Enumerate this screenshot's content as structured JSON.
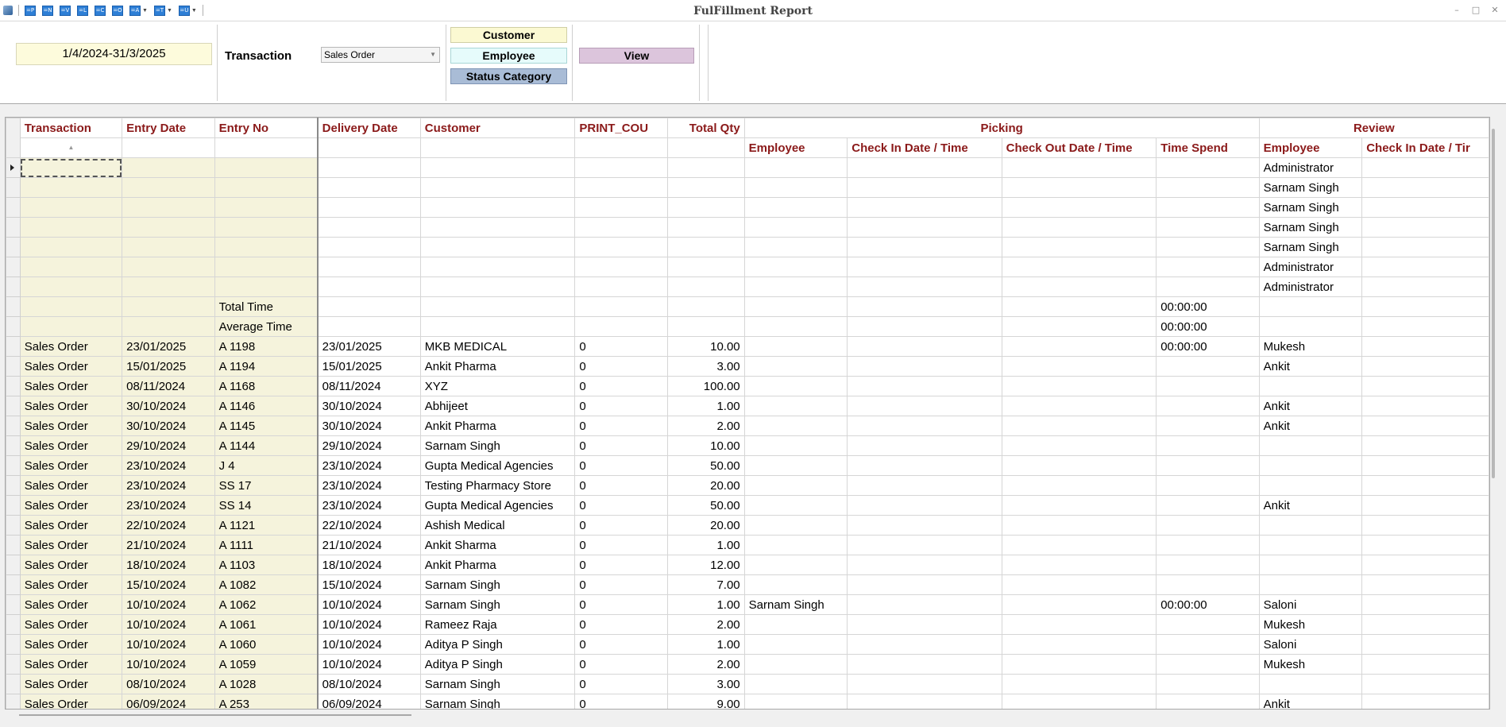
{
  "window": {
    "title": "FulFillment Report",
    "toolbar_buttons": [
      "=P",
      "=N",
      "=V",
      "=L",
      "=C",
      "=O",
      "=A",
      "=T",
      "=U"
    ]
  },
  "filter": {
    "date_range": "1/4/2024-31/3/2025",
    "transaction_label": "Transaction",
    "transaction_value": "Sales Order",
    "customer_button": "Customer",
    "employee_button": "Employee",
    "status_button": "Status Category",
    "view_button": "View",
    "colors": {
      "customer_bg": "#fbf9d2",
      "employee_bg": "#e6fbfb",
      "status_bg": "#a9bcd6",
      "view_bg": "#dcc5dc"
    }
  },
  "grid": {
    "header_color": "#8b1a1a",
    "columns": [
      "Transaction",
      "Entry Date",
      "Entry No",
      "Delivery Date",
      "Customer",
      "PRINT_COU",
      "Total Qty"
    ],
    "group_picking": "Picking",
    "group_review": "Review",
    "sub_columns": [
      "Employee",
      "Check In Date / Time",
      "Check Out Date / Time",
      "Time Spend",
      "Employee",
      "Check In Date / Tir"
    ],
    "rows": [
      [
        "",
        "",
        "",
        "",
        "",
        "",
        "",
        "",
        "",
        "",
        "",
        "Administrator",
        ""
      ],
      [
        "",
        "",
        "",
        "",
        "",
        "",
        "",
        "",
        "",
        "",
        "",
        "Sarnam Singh",
        ""
      ],
      [
        "",
        "",
        "",
        "",
        "",
        "",
        "",
        "",
        "",
        "",
        "",
        "Sarnam Singh",
        ""
      ],
      [
        "",
        "",
        "",
        "",
        "",
        "",
        "",
        "",
        "",
        "",
        "",
        "Sarnam Singh",
        ""
      ],
      [
        "",
        "",
        "",
        "",
        "",
        "",
        "",
        "",
        "",
        "",
        "",
        "Sarnam Singh",
        ""
      ],
      [
        "",
        "",
        "",
        "",
        "",
        "",
        "",
        "",
        "",
        "",
        "",
        "Administrator",
        ""
      ],
      [
        "",
        "",
        "",
        "",
        "",
        "",
        "",
        "",
        "",
        "",
        "",
        "Administrator",
        ""
      ],
      [
        "",
        "",
        "Total Time",
        "",
        "",
        "",
        "",
        "",
        "",
        "",
        "00:00:00",
        "",
        ""
      ],
      [
        "",
        "",
        "Average Time",
        "",
        "",
        "",
        "",
        "",
        "",
        "",
        "00:00:00",
        "",
        ""
      ],
      [
        "Sales Order",
        "23/01/2025",
        "A 1198",
        "23/01/2025",
        "MKB MEDICAL",
        "0",
        "10.00",
        "",
        "",
        "",
        "00:00:00",
        "Mukesh",
        ""
      ],
      [
        "Sales Order",
        "15/01/2025",
        "A 1194",
        "15/01/2025",
        "Ankit Pharma",
        "0",
        "3.00",
        "",
        "",
        "",
        "",
        "Ankit",
        ""
      ],
      [
        "Sales Order",
        "08/11/2024",
        "A 1168",
        "08/11/2024",
        "XYZ",
        "0",
        "100.00",
        "",
        "",
        "",
        "",
        "",
        ""
      ],
      [
        "Sales Order",
        "30/10/2024",
        "A 1146",
        "30/10/2024",
        "Abhijeet",
        "0",
        "1.00",
        "",
        "",
        "",
        "",
        "Ankit",
        ""
      ],
      [
        "Sales Order",
        "30/10/2024",
        "A 1145",
        "30/10/2024",
        "Ankit Pharma",
        "0",
        "2.00",
        "",
        "",
        "",
        "",
        "Ankit",
        ""
      ],
      [
        "Sales Order",
        "29/10/2024",
        "A 1144",
        "29/10/2024",
        "Sarnam Singh",
        "0",
        "10.00",
        "",
        "",
        "",
        "",
        "",
        ""
      ],
      [
        "Sales Order",
        "23/10/2024",
        "J 4",
        "23/10/2024",
        "Gupta Medical Agencies",
        "0",
        "50.00",
        "",
        "",
        "",
        "",
        "",
        ""
      ],
      [
        "Sales Order",
        "23/10/2024",
        "SS 17",
        "23/10/2024",
        "Testing Pharmacy Store",
        "0",
        "20.00",
        "",
        "",
        "",
        "",
        "",
        ""
      ],
      [
        "Sales Order",
        "23/10/2024",
        "SS 14",
        "23/10/2024",
        "Gupta Medical Agencies",
        "0",
        "50.00",
        "",
        "",
        "",
        "",
        "Ankit",
        ""
      ],
      [
        "Sales Order",
        "22/10/2024",
        "A 1121",
        "22/10/2024",
        "Ashish Medical",
        "0",
        "20.00",
        "",
        "",
        "",
        "",
        "",
        ""
      ],
      [
        "Sales Order",
        "21/10/2024",
        "A 1111",
        "21/10/2024",
        "Ankit Sharma",
        "0",
        "1.00",
        "",
        "",
        "",
        "",
        "",
        ""
      ],
      [
        "Sales Order",
        "18/10/2024",
        "A 1103",
        "18/10/2024",
        "Ankit Pharma",
        "0",
        "12.00",
        "",
        "",
        "",
        "",
        "",
        ""
      ],
      [
        "Sales Order",
        "15/10/2024",
        "A 1082",
        "15/10/2024",
        "Sarnam Singh",
        "0",
        "7.00",
        "",
        "",
        "",
        "",
        "",
        ""
      ],
      [
        "Sales Order",
        "10/10/2024",
        "A 1062",
        "10/10/2024",
        "Sarnam Singh",
        "0",
        "1.00",
        "Sarnam Singh",
        "",
        "",
        "00:00:00",
        "Saloni",
        ""
      ],
      [
        "Sales Order",
        "10/10/2024",
        "A 1061",
        "10/10/2024",
        "Rameez Raja",
        "0",
        "2.00",
        "",
        "",
        "",
        "",
        "Mukesh",
        ""
      ],
      [
        "Sales Order",
        "10/10/2024",
        "A 1060",
        "10/10/2024",
        "Aditya P Singh",
        "0",
        "1.00",
        "",
        "",
        "",
        "",
        "Saloni",
        ""
      ],
      [
        "Sales Order",
        "10/10/2024",
        "A 1059",
        "10/10/2024",
        "Aditya P Singh",
        "0",
        "2.00",
        "",
        "",
        "",
        "",
        "Mukesh",
        ""
      ],
      [
        "Sales Order",
        "08/10/2024",
        "A 1028",
        "08/10/2024",
        "Sarnam Singh",
        "0",
        "3.00",
        "",
        "",
        "",
        "",
        "",
        ""
      ],
      [
        "Sales Order",
        "06/09/2024",
        "A 253",
        "06/09/2024",
        "Sarnam Singh",
        "0",
        "9.00",
        "",
        "",
        "",
        "",
        "Ankit",
        ""
      ]
    ]
  }
}
